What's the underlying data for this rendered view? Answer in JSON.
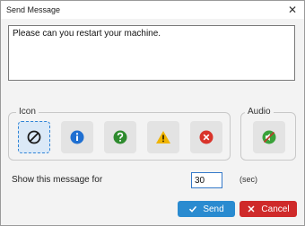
{
  "window": {
    "title": "Send Message",
    "close_glyph": "✕"
  },
  "message": {
    "text": "Please can you restart your machine."
  },
  "icon_group": {
    "label": "Icon",
    "options": [
      {
        "name": "none-icon",
        "selected": true,
        "color": "#1a1a1a"
      },
      {
        "name": "info-icon",
        "selected": false,
        "color": "#1f6fd1"
      },
      {
        "name": "question-icon",
        "selected": false,
        "color": "#2e8b2e"
      },
      {
        "name": "warning-icon",
        "selected": false,
        "color": "#f0b400"
      },
      {
        "name": "error-icon",
        "selected": false,
        "color": "#d9342b"
      }
    ]
  },
  "audio_group": {
    "label": "Audio",
    "icon": "audio-muted-icon",
    "color": "#3aa23a"
  },
  "duration": {
    "label": "Show this message for",
    "value": "30",
    "unit": "(sec)"
  },
  "buttons": {
    "send": {
      "label": "Send",
      "icon": "check-icon",
      "color": "#2a8bd0"
    },
    "cancel": {
      "label": "Cancel",
      "icon": "x-icon",
      "color": "#cf2a2a"
    }
  }
}
